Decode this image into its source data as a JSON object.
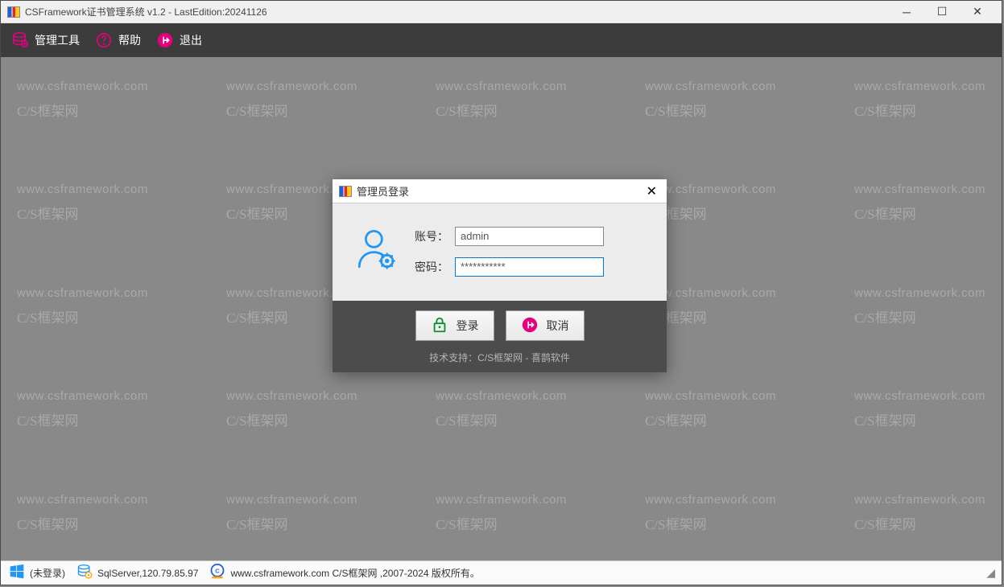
{
  "titlebar": {
    "title": "CSFramework证书管理系统 v1.2 - LastEdition:20241126"
  },
  "toolbar": {
    "tools_label": "管理工具",
    "help_label": "帮助",
    "exit_label": "退出"
  },
  "watermark": {
    "line1": "www.csframework.com",
    "line2": "C/S框架网"
  },
  "dialog": {
    "title": "管理员登录",
    "account_label": "账号：",
    "account_value": "admin",
    "password_label": "密码：",
    "password_value": "***********",
    "login_label": "登录",
    "cancel_label": "取消",
    "footer": "技术支持：C/S框架网 - 喜鹊软件"
  },
  "statusbar": {
    "login_status": "(未登录)",
    "server": "SqlServer,120.79.85.97",
    "copyright": "www.csframework.com C/S框架网 ,2007-2024 版权所有。"
  }
}
